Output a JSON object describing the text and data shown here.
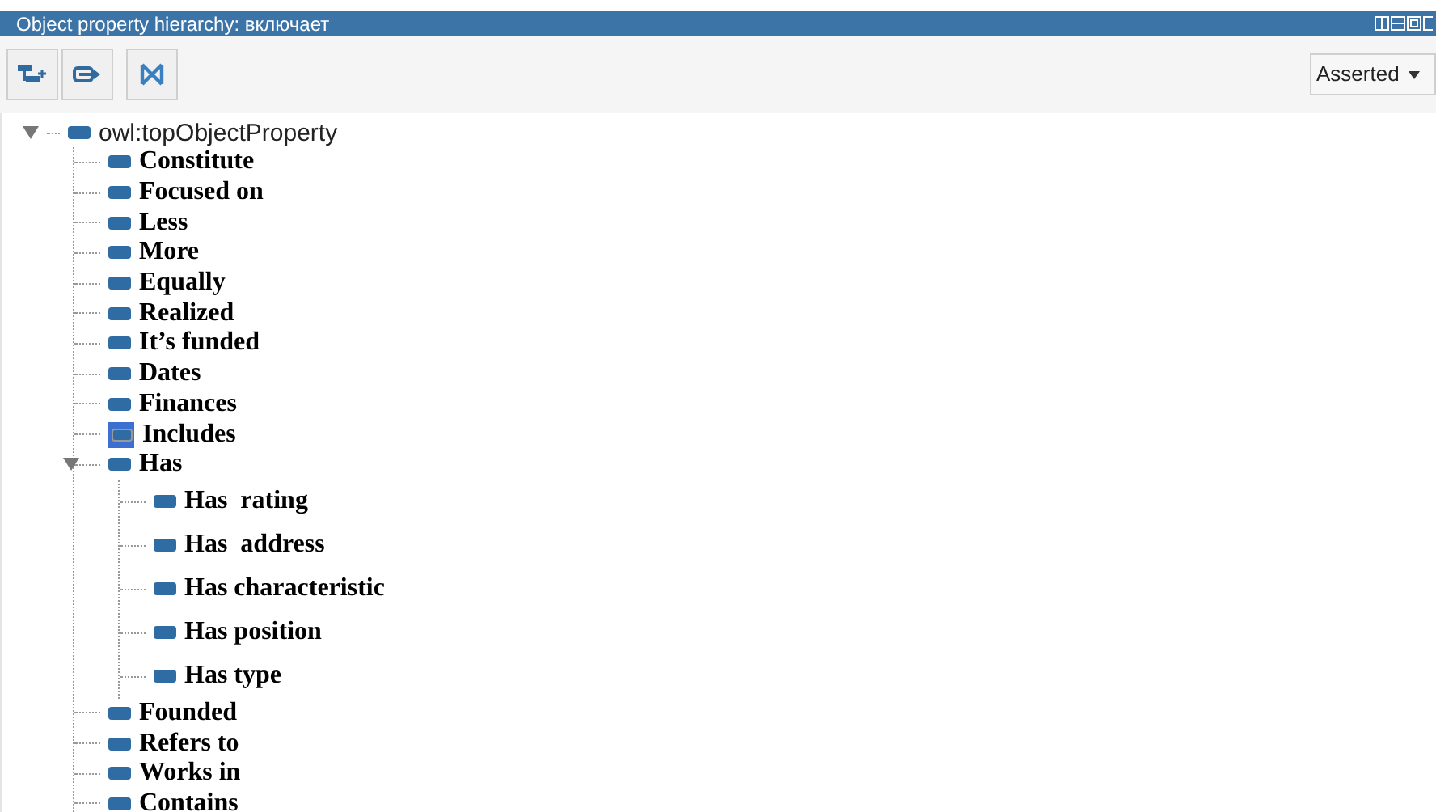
{
  "view": {
    "title": "Object property hierarchy: включает"
  },
  "toolbar": {
    "dropdown": {
      "value": "Asserted"
    }
  },
  "tree": [
    {
      "label": "owl:topObjectProperty",
      "selected": false,
      "expanded": true,
      "children": [
        {
          "label": "Constitute",
          "selected": false
        },
        {
          "label": "Focused on",
          "selected": false
        },
        {
          "label": "Less",
          "selected": false
        },
        {
          "label": "More",
          "selected": false
        },
        {
          "label": "Equally",
          "selected": false
        },
        {
          "label": "Realized",
          "selected": false
        },
        {
          "label": "It’s funded",
          "selected": false
        },
        {
          "label": "Dates",
          "selected": false
        },
        {
          "label": "Finances",
          "selected": false
        },
        {
          "label": "Includes",
          "selected": true
        },
        {
          "label": "Has",
          "selected": false,
          "expanded": true,
          "children": [
            {
              "label": "Has  rating",
              "selected": false
            },
            {
              "label": "Has  address",
              "selected": false
            },
            {
              "label": "Has characteristic",
              "selected": false
            },
            {
              "label": "Has position",
              "selected": false
            },
            {
              "label": "Has type",
              "selected": false
            }
          ]
        },
        {
          "label": "Founded",
          "selected": false
        },
        {
          "label": "Refers to",
          "selected": false
        },
        {
          "label": "Works in",
          "selected": false
        },
        {
          "label": "Contains",
          "selected": false
        }
      ]
    }
  ]
}
